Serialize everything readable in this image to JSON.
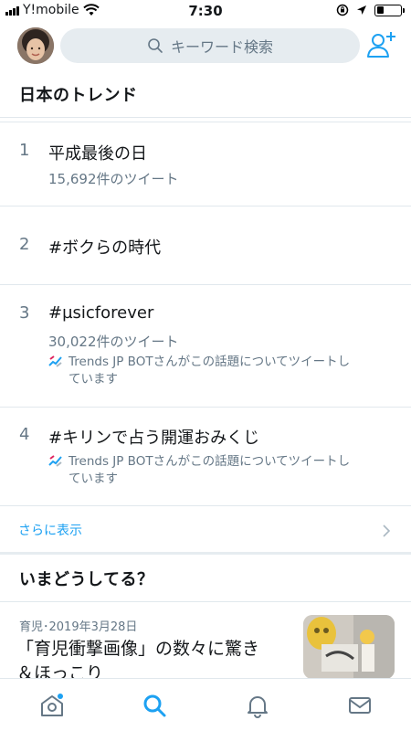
{
  "status_bar": {
    "carrier": "Y!mobile",
    "time": "7:30",
    "battery_level": 0.3
  },
  "header": {
    "avatar_icon": "user-avatar-photo",
    "search_placeholder": "キーワード検索",
    "search_icon": "search-icon",
    "add_user_icon": "add-user-icon"
  },
  "trends": {
    "title": "日本のトレンド",
    "items": [
      {
        "rank": "1",
        "name": "平成最後の日",
        "count": "15,692件のツイート"
      },
      {
        "rank": "2",
        "name": "#ボクらの時代"
      },
      {
        "rank": "3",
        "name": "#µsicforever",
        "count": "30,022件のツイート",
        "context_line1": "Trends JP BOTさんがこの話題についてツイートし",
        "context_line2": "ています"
      },
      {
        "rank": "4",
        "name": "#キリンで占う開運おみくじ",
        "context_line1": "Trends JP BOTさんがこの話題についてツイートし",
        "context_line2": "ています"
      }
    ],
    "show_more": "さらに表示"
  },
  "whats_happening": {
    "title": "いまどうしてる？",
    "news": {
      "meta": "育児･2019年3月28日",
      "title_line1": "「育児衝撃画像」の数々に驚き",
      "title_line2": "＆ほっこり"
    }
  },
  "tabbar": {
    "tabs": [
      "home-icon",
      "search-icon",
      "notifications-icon",
      "messages-icon"
    ],
    "active": "search-icon",
    "active_color": "#1da1f2",
    "inactive_color": "#657786"
  }
}
